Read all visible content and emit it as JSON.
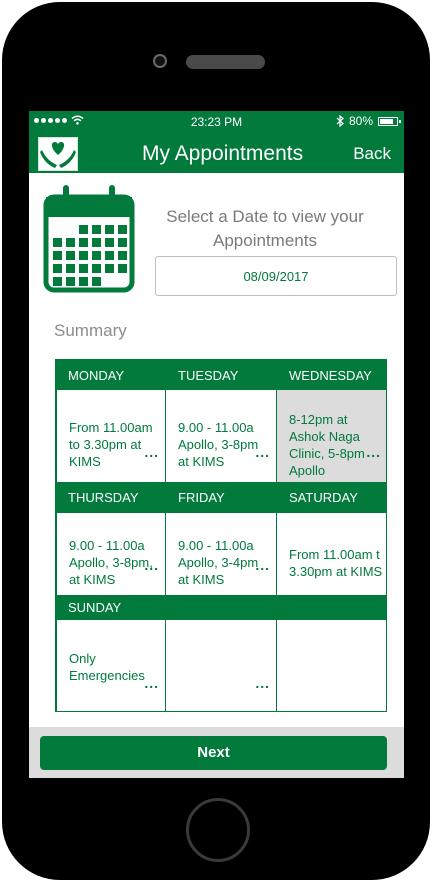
{
  "status": {
    "time": "23:23 PM",
    "battery": "80%"
  },
  "appbar": {
    "title": "My Appointments",
    "back_label": "Back"
  },
  "prompt": {
    "line1": "Select a Date to view your",
    "line2": "Appointments"
  },
  "date": {
    "value": "08/09/2017"
  },
  "summary_label": "Summary",
  "days": [
    {
      "name": "MONDAY",
      "text": "From 11.00am\nto 3.30pm at\nKIMS",
      "more": "..."
    },
    {
      "name": "TUESDAY",
      "text": "9.00 - 11.00a\nApollo, 3-8pm\nat KIMS",
      "more": "..."
    },
    {
      "name": "WEDNESDAY",
      "text": "8-12pm at\nAshok Naga\nClinic, 5-8pm\nApollo",
      "more": "..."
    },
    {
      "name": "THURSDAY",
      "text": "9.00 - 11.00a\nApollo, 3-8pm,\nat KIMS",
      "more": "..."
    },
    {
      "name": "FRIDAY",
      "text": "9.00 - 11.00a\nApollo, 3-4pm\nat KIMS",
      "more": "..."
    },
    {
      "name": "SATURDAY",
      "text": "From 11.00am t\n3.30pm at KIMS",
      "more": ""
    },
    {
      "name": "SUNDAY",
      "text": "Only\nEmergencies",
      "more": "..."
    }
  ],
  "extra_cells": [
    {
      "text": "",
      "more": "..."
    },
    {
      "text": "",
      "more": ""
    }
  ],
  "footer": {
    "next_label": "Next"
  },
  "colors": {
    "brand_green": "#017a3c",
    "footer_grey": "#dcdcdc"
  }
}
